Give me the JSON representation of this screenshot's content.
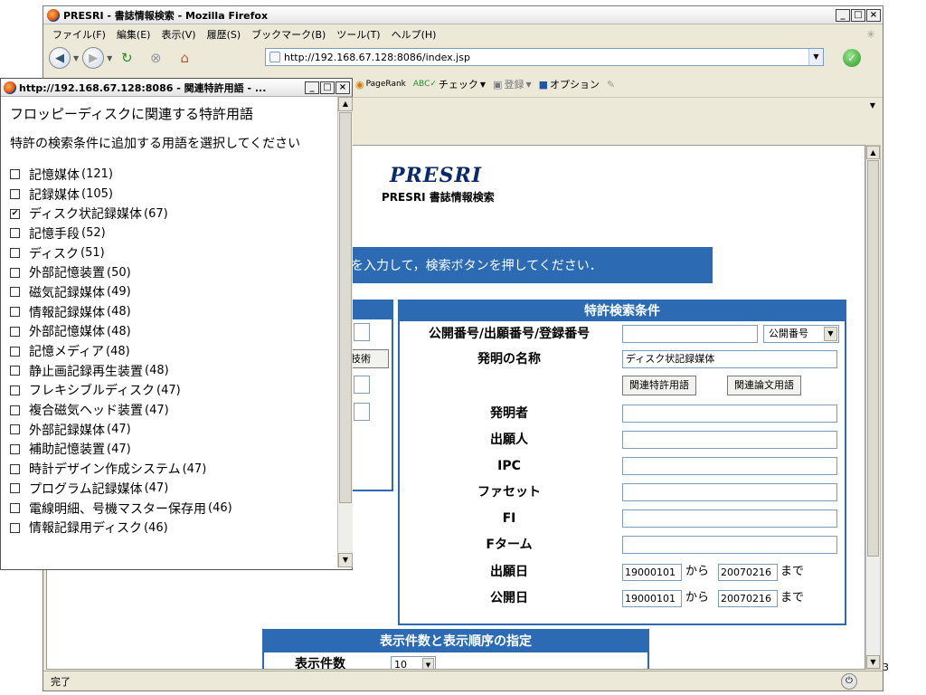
{
  "browser": {
    "title": "PRESRI - 書誌情報検索 - Mozilla Firefox",
    "menus": [
      "ファイル(F)",
      "編集(E)",
      "表示(V)",
      "履歴(S)",
      "ブックマーク(B)",
      "ツール(T)",
      "ヘルプ(H)"
    ],
    "url": "http://192.168.67.128:8086/index.jsp",
    "toolbar2": {
      "pagerank": "PageRank",
      "check": "チェック",
      "register": "登録",
      "options": "オプション"
    },
    "status": "完了"
  },
  "page": {
    "logo_text": "PRESRI",
    "subtitle": "PRESRI 書誌情報検索",
    "banner": "を入力して，検索ボタンを押してください．",
    "left_panel_button": "技術",
    "patent": {
      "heading": "特許検索条件",
      "number_label": "公開番号/出願番号/登録番号",
      "number_select": "公開番号",
      "title_label": "発明の名称",
      "title_value": "ディスク状記録媒体",
      "related_patent_button": "関連特許用語",
      "related_paper_button": "関連論文用語",
      "fields": [
        "発明者",
        "出願人",
        "IPC",
        "ファセット",
        "FI",
        "Fターム"
      ],
      "filing_label": "出願日",
      "publication_label": "公開日",
      "date_from": "19000101",
      "date_to": "20070216",
      "from_text": "から",
      "to_text": "まで"
    },
    "display": {
      "heading": "表示件数と表示順序の指定",
      "count_label": "表示件数",
      "count_value": "10"
    },
    "page_number": "3"
  },
  "popup": {
    "title": "http://192.168.67.128:8086 - 関連特許用語 - ...",
    "heading": "フロッピーディスクに関連する特許用語",
    "instruction": "特許の検索条件に追加する用語を選択してください",
    "items": [
      {
        "label": "記憶媒体",
        "count": "(121)",
        "checked": false
      },
      {
        "label": "記録媒体",
        "count": "(105)",
        "checked": false
      },
      {
        "label": "ディスク状記録媒体",
        "count": "(67)",
        "checked": true
      },
      {
        "label": "記憶手段",
        "count": "(52)",
        "checked": false
      },
      {
        "label": "ディスク",
        "count": "(51)",
        "checked": false
      },
      {
        "label": "外部記憶装置",
        "count": "(50)",
        "checked": false
      },
      {
        "label": "磁気記録媒体",
        "count": "(49)",
        "checked": false
      },
      {
        "label": "情報記録媒体",
        "count": "(48)",
        "checked": false
      },
      {
        "label": "外部記憶媒体",
        "count": "(48)",
        "checked": false
      },
      {
        "label": "記憶メディア",
        "count": "(48)",
        "checked": false
      },
      {
        "label": "静止画記録再生装置",
        "count": "(48)",
        "checked": false
      },
      {
        "label": "フレキシブルディスク",
        "count": "(47)",
        "checked": false
      },
      {
        "label": "複合磁気ヘッド装置",
        "count": "(47)",
        "checked": false
      },
      {
        "label": "外部記録媒体",
        "count": "(47)",
        "checked": false
      },
      {
        "label": "補助記憶装置",
        "count": "(47)",
        "checked": false
      },
      {
        "label": "時計デザイン作成システム",
        "count": "(47)",
        "checked": false
      },
      {
        "label": "プログラム記録媒体",
        "count": "(47)",
        "checked": false
      },
      {
        "label": "電線明細、号機マスター保存用",
        "count": "(46)",
        "checked": false
      },
      {
        "label": "情報記録用ディスク",
        "count": "(46)",
        "checked": false
      }
    ]
  }
}
